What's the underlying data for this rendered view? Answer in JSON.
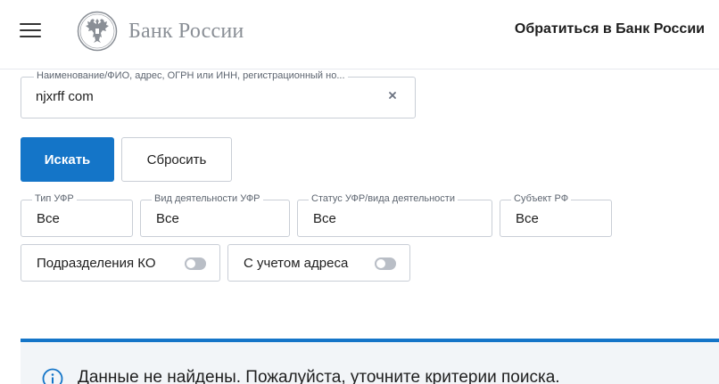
{
  "header": {
    "menu_icon": "hamburger-menu-icon",
    "logo_icon": "double-headed-eagle-emblem",
    "logo_text": "Банк России",
    "contact_link": "Обратиться в Банк России"
  },
  "search": {
    "label": "Наименование/ФИО, адрес, ОГРН или ИНН, регистрационный но...",
    "value": "njxrff com",
    "clear_icon": "close-icon"
  },
  "actions": {
    "search_label": "Искать",
    "reset_label": "Сбросить"
  },
  "filters": [
    {
      "label": "Тип УФР",
      "value": "Все"
    },
    {
      "label": "Вид деятельности УФР",
      "value": "Все"
    },
    {
      "label": "Статус УФР/вида деятельности",
      "value": "Все"
    },
    {
      "label": "Субъект РФ",
      "value": "Все"
    }
  ],
  "toggles": [
    {
      "label": "Подразделения КО",
      "checked": false
    },
    {
      "label": "С учетом адреса",
      "checked": false
    }
  ],
  "notice": {
    "icon": "info-icon",
    "text": "Данные не найдены. Пожалуйста, уточните критерии поиска."
  },
  "colors": {
    "accent": "#1475c8",
    "border": "#c9ced6",
    "notice_bg": "#f2f5f8",
    "logo_gray": "#8a8f96"
  }
}
